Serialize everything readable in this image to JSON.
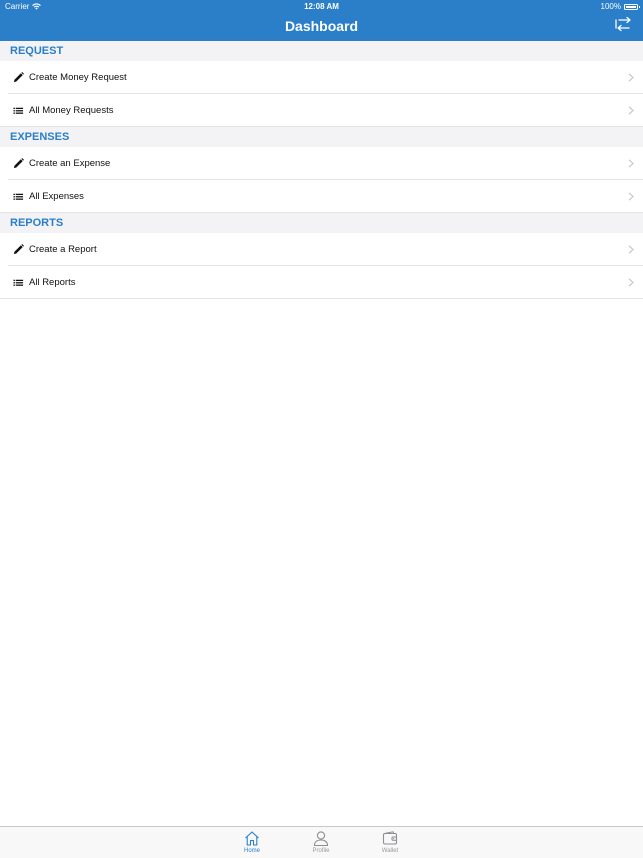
{
  "status_bar": {
    "carrier": "Carrier",
    "time": "12:08 AM",
    "battery": "100%"
  },
  "nav": {
    "title": "Dashboard",
    "logout_icon": "logout-arrows-icon"
  },
  "sections": [
    {
      "title": "REQUEST",
      "items": [
        {
          "label": "Create Money Request",
          "icon": "pencil-icon"
        },
        {
          "label": "All Money Requests",
          "icon": "list-icon"
        }
      ]
    },
    {
      "title": "EXPENSES",
      "items": [
        {
          "label": "Create an Expense",
          "icon": "pencil-icon"
        },
        {
          "label": "All Expenses",
          "icon": "list-icon"
        }
      ]
    },
    {
      "title": "REPORTS",
      "items": [
        {
          "label": "Create a Report",
          "icon": "pencil-icon"
        },
        {
          "label": "All Reports",
          "icon": "list-icon"
        }
      ]
    }
  ],
  "tabbar": {
    "tabs": [
      {
        "label": "Home",
        "icon": "home-icon",
        "active": true
      },
      {
        "label": "Profile",
        "icon": "person-icon",
        "active": false
      },
      {
        "label": "Wallet",
        "icon": "wallet-icon",
        "active": false
      }
    ]
  },
  "colors": {
    "accent": "#2a7fc8",
    "section_background": "#f3f3f5",
    "inactive_tab": "#9a9a9e"
  }
}
